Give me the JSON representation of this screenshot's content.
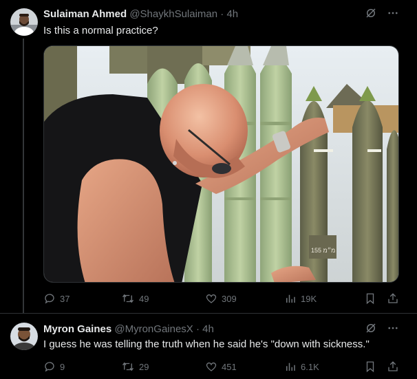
{
  "tweets": [
    {
      "author": {
        "name": "Sulaiman Ahmed",
        "handle": "@ShaykhSulaiman",
        "time": "4h"
      },
      "text": "Is this a normal practice?",
      "media": {
        "shell_marking": "מ״מ 155",
        "arrow_label": "→"
      },
      "stats": {
        "replies": "37",
        "reposts": "49",
        "likes": "309",
        "views": "19K"
      }
    },
    {
      "author": {
        "name": "Myron Gaines",
        "handle": "@MyronGainesX",
        "time": "4h"
      },
      "text": "I guess he was telling the truth when he said he's \"down with sickness.\"",
      "stats": {
        "replies": "9",
        "reposts": "29",
        "likes": "451",
        "views": "6.1K"
      }
    }
  ],
  "separator": "·",
  "colors": {
    "background": "#000000",
    "text": "#e7e9ea",
    "muted": "#71767b",
    "divider": "#2f3336"
  },
  "icons": [
    "grok-icon",
    "more-icon",
    "reply-icon",
    "repost-icon",
    "like-icon",
    "views-icon",
    "bookmark-icon",
    "share-icon"
  ]
}
